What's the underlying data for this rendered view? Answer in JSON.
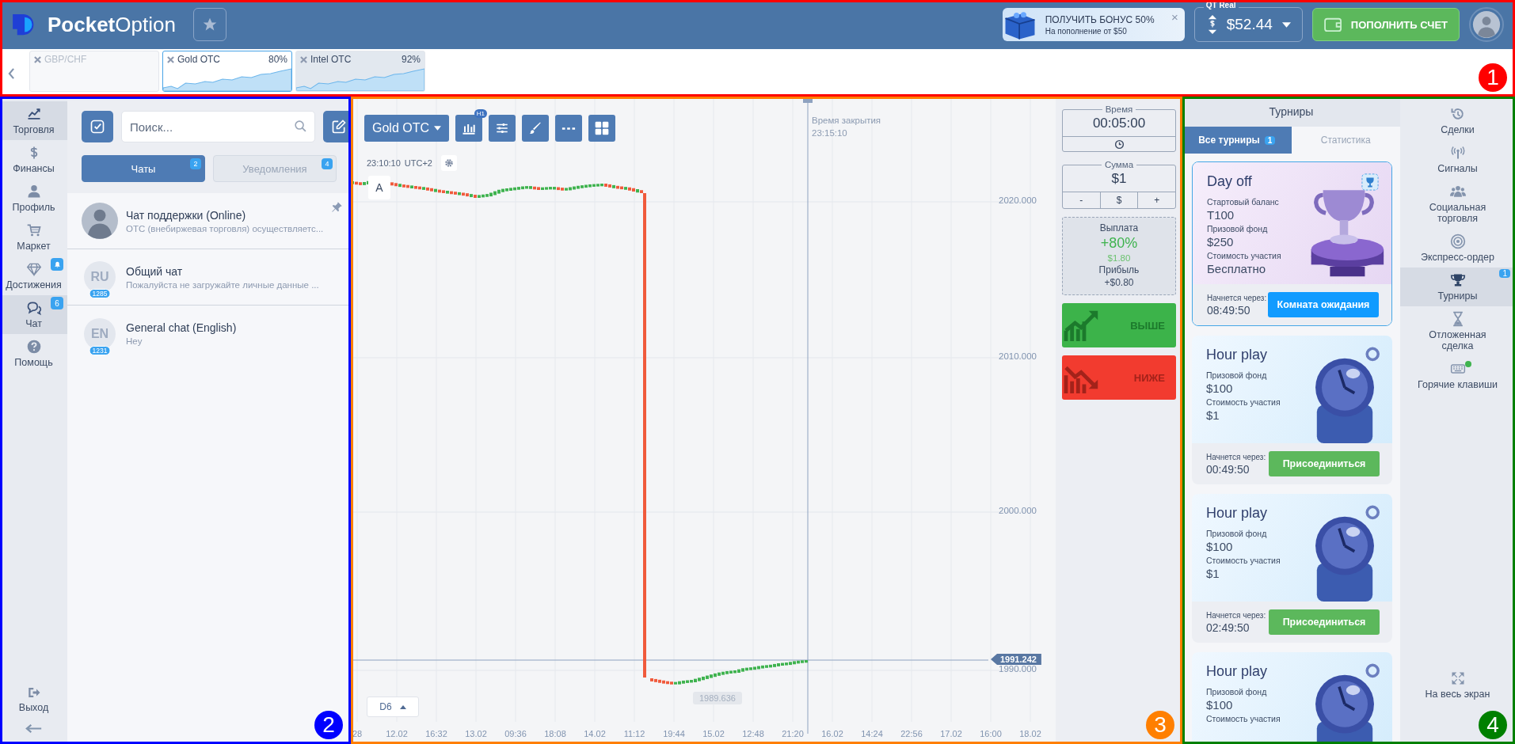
{
  "annotations": [
    {
      "label": "1",
      "color": "#ff0000"
    },
    {
      "label": "2",
      "color": "#0000ff"
    },
    {
      "label": "3",
      "color": "#ff7f00"
    },
    {
      "label": "4",
      "color": "#008000"
    }
  ],
  "header": {
    "logo_text": "**Pocket**Option",
    "bonus": {
      "title": "ПОЛУЧИТЬ БОНУС 50%",
      "subtitle": "На пополнение от $50",
      "close": "×"
    },
    "account": {
      "label": "QT Real",
      "balance": "$52.44"
    },
    "deposit_button": "ПОПОЛНИТЬ СЧЕТ"
  },
  "asset_tabs": [
    {
      "name": "GBP/CHF",
      "disabled": true,
      "selected": false
    },
    {
      "name": "Gold OTC",
      "payout": "80%",
      "disabled": false,
      "selected": true
    },
    {
      "name": "Intel OTC",
      "payout": "92%",
      "disabled": false,
      "selected": false
    }
  ],
  "left_nav": {
    "items": [
      {
        "label": "Торговля",
        "selected": true
      },
      {
        "label": "Финансы",
        "selected": false
      },
      {
        "label": "Профиль",
        "selected": false
      },
      {
        "label": "Маркет",
        "selected": false
      },
      {
        "label": "Достижения",
        "selected": false,
        "alert": true
      },
      {
        "label": "Чат",
        "selected": true,
        "badge": "6"
      },
      {
        "label": "Помощь",
        "selected": false
      }
    ],
    "exit": "Выход"
  },
  "chat_panel": {
    "search": {
      "placeholder": "Поиск..."
    },
    "tabs": [
      {
        "label": "Чаты",
        "badge": "2",
        "selected": true
      },
      {
        "label": "Уведомления",
        "badge": "4",
        "selected": false
      }
    ],
    "chats": [
      {
        "name": "Чат поддержки (Online)",
        "preview": "ОТС (внебиржевая торговля) осуществляетс...",
        "pinned": true
      },
      {
        "name": "Общий чат",
        "preview": "Пожалуйста не загружайте личные данные ...",
        "avatar": "RU",
        "count": "1285",
        "pinned": false
      },
      {
        "name": "General chat (English)",
        "preview": "Hey",
        "avatar": "EN",
        "count": "1231",
        "pinned": false
      }
    ]
  },
  "chart": {
    "asset": "Gold OTC",
    "timeframe_badge": "H1",
    "time": "23:10:10",
    "timezone": "UTC+2",
    "scale_button": "A",
    "close_time_label": "Время закрытия",
    "close_time": "23:15:10",
    "y_labels": [
      "2020.000",
      "2010.000",
      "2000.000",
      "1990.000"
    ],
    "current_price": "1991.242",
    "low_price": "1989.636",
    "period": "D6",
    "x_labels": [
      "28",
      "12.02",
      "16:32",
      "13.02",
      "09:36",
      "18:08",
      "14.02",
      "11:12",
      "19:44",
      "15.02",
      "12:48",
      "21:20",
      "16.02",
      "14:24",
      "22:56",
      "17.02",
      "16:00",
      "18.02"
    ]
  },
  "trade_panel": {
    "time_label": "Время",
    "time": "00:05:00",
    "amount_label": "Сумма",
    "amount": "$1",
    "amount_buttons": [
      "-",
      "$",
      "+"
    ],
    "payout_label": "Выплата",
    "payout": "+80%",
    "payout_amount": "$1.80",
    "profit_label": "Прибыль",
    "profit": "+$0.80",
    "up_button": "ВЫШЕ",
    "down_button": "НИЖЕ"
  },
  "tournaments": {
    "title": "Турниры",
    "tabs": [
      {
        "label": "Все турниры",
        "badge": "1",
        "selected": true
      },
      {
        "label": "Статистика",
        "selected": false
      }
    ],
    "cards": [
      {
        "kind": "featured",
        "title": "Day off",
        "fields": [
          {
            "label": "Стартовый баланс",
            "value": "T100"
          },
          {
            "label": "Призовой фонд",
            "value": "$250"
          },
          {
            "label": "Стоимость участия",
            "value": "Бесплатно"
          }
        ],
        "starts_label": "Начнется через:",
        "starts_in": "08:49:50",
        "button": "Комната ожидания"
      },
      {
        "kind": "regular",
        "title": "Hour play",
        "fields": [
          {
            "label": "Призовой фонд",
            "value": "$100"
          },
          {
            "label": "Стоимость участия",
            "value": "$1"
          }
        ],
        "starts_label": "Начнется через:",
        "starts_in": "00:49:50",
        "button": "Присоединиться"
      },
      {
        "kind": "regular",
        "title": "Hour play",
        "fields": [
          {
            "label": "Призовой фонд",
            "value": "$100"
          },
          {
            "label": "Стоимость участия",
            "value": "$1"
          }
        ],
        "starts_label": "Начнется через:",
        "starts_in": "02:49:50",
        "button": "Присоединиться"
      },
      {
        "kind": "regular",
        "title": "Hour play",
        "fields": [
          {
            "label": "Призовой фонд",
            "value": "$100"
          },
          {
            "label": "Стоимость участия"
          }
        ]
      }
    ]
  },
  "right_nav": {
    "items": [
      {
        "label": "Сделки",
        "selected": false
      },
      {
        "label": "Сигналы",
        "selected": false
      },
      {
        "label": "Социальная торговля",
        "selected": false
      },
      {
        "label": "Экспресс-ордер",
        "selected": false
      },
      {
        "label": "Турниры",
        "selected": true,
        "badge": "1"
      },
      {
        "label": "Отложенная сделка",
        "selected": false
      },
      {
        "label": "Горячие клавиши",
        "selected": false,
        "dot": true
      }
    ],
    "fullscreen": "На весь экран"
  }
}
